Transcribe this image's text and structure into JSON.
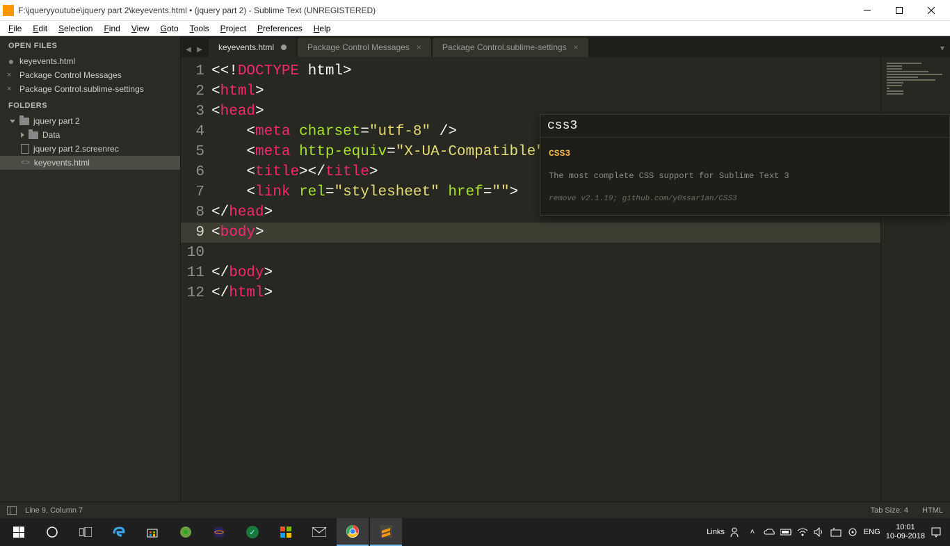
{
  "titlebar": {
    "title": "F:\\jqueryyoutube\\jquery part 2\\keyevents.html • (jquery part 2) - Sublime Text (UNREGISTERED)"
  },
  "menubar": [
    "File",
    "Edit",
    "Selection",
    "Find",
    "View",
    "Goto",
    "Tools",
    "Project",
    "Preferences",
    "Help"
  ],
  "sidebar": {
    "open_files_header": "OPEN FILES",
    "open_files": [
      {
        "name": "keyevents.html",
        "dirty": true
      },
      {
        "name": "Package Control Messages",
        "dirty": false
      },
      {
        "name": "Package Control.sublime-settings",
        "dirty": false
      }
    ],
    "folders_header": "FOLDERS",
    "root": "jquery part 2",
    "children": [
      {
        "name": "Data",
        "type": "folder"
      },
      {
        "name": "jquery part 2.screenrec",
        "type": "file"
      },
      {
        "name": "keyevents.html",
        "type": "code",
        "selected": true
      }
    ]
  },
  "tabs": [
    {
      "label": "keyevents.html",
      "active": true,
      "dirty": true
    },
    {
      "label": "Package Control Messages",
      "active": false,
      "dirty": false
    },
    {
      "label": "Package Control.sublime-settings",
      "active": false,
      "dirty": false
    }
  ],
  "popup": {
    "input": "css3",
    "result_title": "CSS3",
    "result_desc": "The most complete CSS support for Sublime Text 3",
    "result_meta": "remove v2.1.19; github.com/y0ssar1an/CSS3"
  },
  "code": {
    "lines": [
      {
        "n": 1,
        "html": "<span class='p-punc'>&lt;&lt;!</span><span class='p-doctype'>DOCTYPE</span><span class='p-text'> html</span><span class='p-punc'>&gt;</span>"
      },
      {
        "n": 2,
        "html": "<span class='p-punc'>&lt;</span><span class='p-tag'>html</span><span class='p-punc'>&gt;</span>"
      },
      {
        "n": 3,
        "html": "<span class='p-punc'>&lt;</span><span class='p-tag'>head</span><span class='p-punc'>&gt;</span>"
      },
      {
        "n": 4,
        "html": "    <span class='p-punc'>&lt;</span><span class='p-tag'>meta</span> <span class='p-attr'>charset</span><span class='p-punc'>=</span><span class='p-str'>\"utf-8\"</span> <span class='p-punc'>/&gt;</span>"
      },
      {
        "n": 5,
        "html": "    <span class='p-punc'>&lt;</span><span class='p-tag'>meta</span> <span class='p-attr'>http-equiv</span><span class='p-punc'>=</span><span class='p-str'>\"X-UA-Compatible\"</span> <span class='p-attr'>content</span><span class='p-punc'>=</span><span class='p-str'>\"IE=edge\"</span><span class='p-punc'>&gt;</span>"
      },
      {
        "n": 6,
        "html": "    <span class='p-punc'>&lt;</span><span class='p-tag'>title</span><span class='p-punc'>&gt;&lt;/</span><span class='p-tag'>title</span><span class='p-punc'>&gt;</span>"
      },
      {
        "n": 7,
        "html": "    <span class='p-punc'>&lt;</span><span class='p-tag'>link</span> <span class='p-attr'>rel</span><span class='p-punc'>=</span><span class='p-str'>\"stylesheet\"</span> <span class='p-attr'>href</span><span class='p-punc'>=</span><span class='p-str'>\"\"</span><span class='p-punc'>&gt;</span>"
      },
      {
        "n": 8,
        "html": "<span class='p-punc'>&lt;/</span><span class='p-tag'>head</span><span class='p-punc'>&gt;</span>"
      },
      {
        "n": 9,
        "html": "<span class='p-punc'>&lt;</span><span class='p-tag'>body</span><span class='p-punc'>&gt;</span>",
        "current": true
      },
      {
        "n": 10,
        "html": ""
      },
      {
        "n": 11,
        "html": "<span class='p-punc'>&lt;/</span><span class='p-tag'>body</span><span class='p-punc'>&gt;</span>"
      },
      {
        "n": 12,
        "html": "<span class='p-punc'>&lt;/</span><span class='p-tag'>html</span><span class='p-punc'>&gt;</span>"
      }
    ]
  },
  "statusbar": {
    "pos": "Line 9, Column 7",
    "tab_size": "Tab Size: 4",
    "syntax": "HTML"
  },
  "taskbar": {
    "links": "Links",
    "lang": "ENG",
    "time": "10:01",
    "date": "10-09-2018"
  }
}
